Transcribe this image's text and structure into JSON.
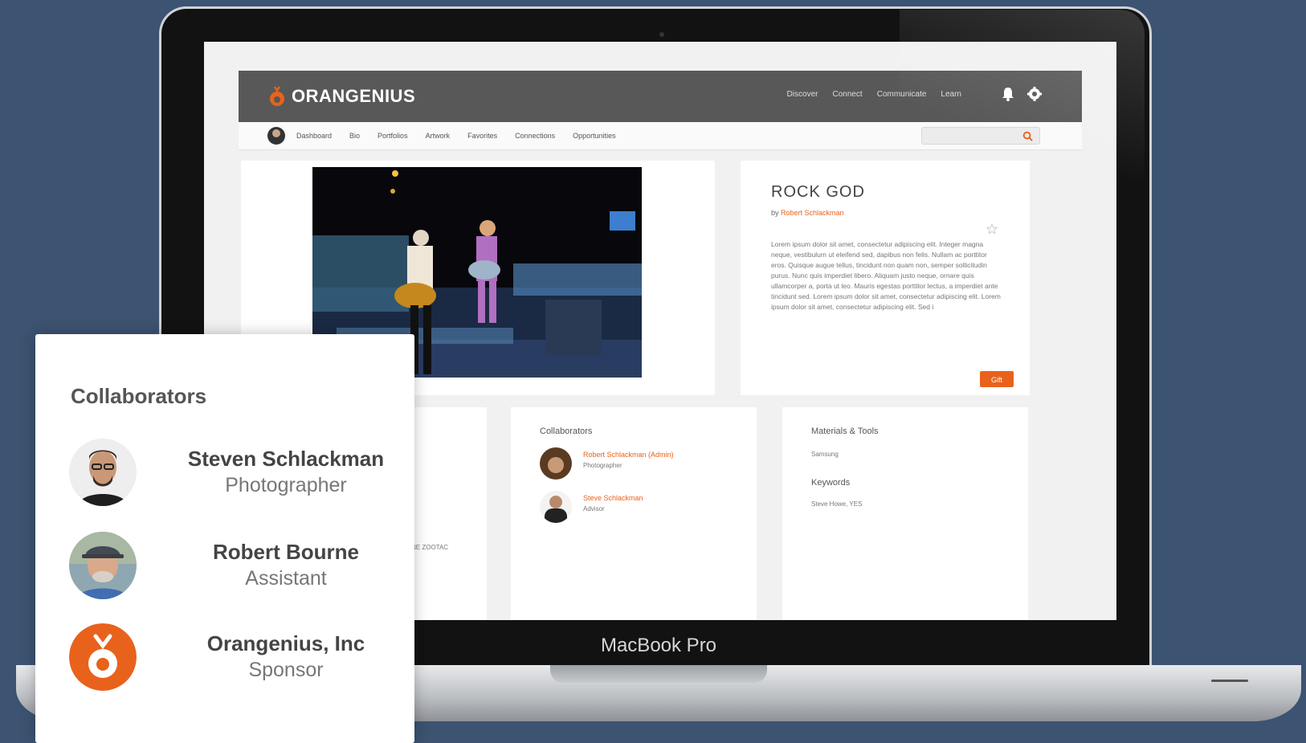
{
  "laptop": {
    "brand_label": "MacBook Pro"
  },
  "app": {
    "logo_text": "ORANGENIUS",
    "top_nav": [
      "Discover",
      "Connect",
      "Communicate",
      "Learn"
    ],
    "sub_nav": [
      "Dashboard",
      "Bio",
      "Portfolios",
      "Artwork",
      "Favorites",
      "Connections",
      "Opportunities"
    ],
    "search": {
      "placeholder": ""
    },
    "accent_color": "#e8621c"
  },
  "artwork": {
    "title": "ROCK GOD",
    "by_prefix": "by",
    "author": "Robert Schlackman",
    "description": "Lorem ipsum dolor sit amet, consectetur adipiscing elit. Integer magna neque, vestibulum ut eleifend sed, dapibus non felis. Nullam ac porttitor eros. Quisque augue tellus, tincidunt non quam non, semper sollicitudin purus. Nunc quis imperdiet libero. Aliquam justo neque, ornare quis ullamcorper a, porta ut leo. Mauris egestas porttitor lectus, a imperdiet ante tincidunt sed. Lorem ipsum dolor sit amet, consectetur adipiscing elit. Lorem ipsum dolor sit amet, consectetur adipiscing elit. Sed i",
    "gift_label": "Gift"
  },
  "left_card": {
    "text": "DONE ZOOTAC"
  },
  "collab_card": {
    "heading": "Collaborators",
    "people": [
      {
        "name": "Robert Schlackman (Admin)",
        "role": "Photographer"
      },
      {
        "name": "Steve Schlackman",
        "role": "Advisor"
      }
    ]
  },
  "materials_card": {
    "heading": "Materials & Tools",
    "materials": "Samsung",
    "keywords_heading": "Keywords",
    "keywords": "Steve Howe, YES"
  },
  "overlay": {
    "title": "Collaborators",
    "people": [
      {
        "name": "Steven Schlackman",
        "role": "Photographer",
        "avatar": "person-avatar"
      },
      {
        "name": "Robert Bourne",
        "role": "Assistant",
        "avatar": "person-avatar"
      },
      {
        "name": "Orangenius, Inc",
        "role": "Sponsor",
        "avatar": "orange-logo-icon"
      }
    ]
  }
}
